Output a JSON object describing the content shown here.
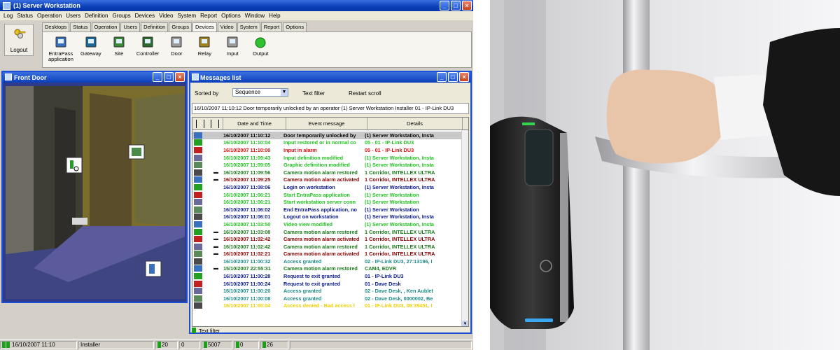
{
  "window": {
    "title": "(1)  Server Workstation"
  },
  "menu": [
    "Log",
    "Status",
    "Operation",
    "Users",
    "Definition",
    "Groups",
    "Devices",
    "Video",
    "System",
    "Report",
    "Options",
    "Window",
    "Help"
  ],
  "logout_label": "Logout",
  "tabs": [
    "Desktops",
    "Status",
    "Operation",
    "Users",
    "Definition",
    "Groups",
    "Devices",
    "Video",
    "System",
    "Report",
    "Options"
  ],
  "active_tab": "Devices",
  "toolbar": [
    {
      "label": "EntraPass\napplication",
      "icon": "computer-icon"
    },
    {
      "label": "Gateway",
      "icon": "gateway-icon"
    },
    {
      "label": "Site",
      "icon": "site-icon"
    },
    {
      "label": "Controller",
      "icon": "controller-icon"
    },
    {
      "label": "Door",
      "icon": "door-icon"
    },
    {
      "label": "Relay",
      "icon": "relay-icon"
    },
    {
      "label": "Input",
      "icon": "input-icon"
    },
    {
      "label": "Output",
      "icon": "output-icon"
    }
  ],
  "front_door": {
    "title": "Front Door"
  },
  "messages": {
    "title": "Messages list",
    "sorted_by_label": "Sorted by",
    "sorted_by_value": "Sequence",
    "text_filter_label": "Text filter",
    "restart_scroll_label": "Restart scroll",
    "last_message": "16/10/2007 11:10:12  Door temporarily unlocked by an operator  (1)  Server Workstation  Installer  01 - IP-Link DU3",
    "columns": [
      "Date and Time",
      "Event message",
      "Details"
    ],
    "rows": [
      {
        "dt": "16/10/2007 11:10:12",
        "ev": "Door temporarily unlocked by",
        "de": "(1)  Server Workstation, Insta",
        "color": "#000000",
        "cam": false,
        "selected": true
      },
      {
        "dt": "16/10/2007 11:10:04",
        "ev": "Input restored or in normal co",
        "de": "05 - 01 - IP-Link DU3",
        "color": "#22c322",
        "cam": false
      },
      {
        "dt": "16/10/2007 11:10:00",
        "ev": "Input in alarm",
        "de": "05 - 01 - IP-Link DU3",
        "color": "#e21010",
        "cam": false
      },
      {
        "dt": "16/10/2007 11:09:43",
        "ev": "Input definition modified",
        "de": "(1)  Server Workstation, Insta",
        "color": "#22c322",
        "cam": false
      },
      {
        "dt": "16/10/2007 11:09:05",
        "ev": "Graphic definition modified",
        "de": "(1)  Server Workstation, Insta",
        "color": "#22c322",
        "cam": false
      },
      {
        "dt": "16/10/2007 11:09:56",
        "ev": "Camera motion alarm restored",
        "de": "1 Corridor, INTELLEX ULTRA",
        "color": "#1a7a1a",
        "cam": true
      },
      {
        "dt": "16/10/2007 11:09:25",
        "ev": "Camera motion alarm activated",
        "de": "1 Corridor, INTELLEX ULTRA",
        "color": "#8b0000",
        "cam": true
      },
      {
        "dt": "16/10/2007 11:08:06",
        "ev": "Login on workstation",
        "de": "(1)  Server Workstation, Insta",
        "color": "#0a1a8c",
        "cam": false
      },
      {
        "dt": "16/10/2007 11:06:21",
        "ev": "Start EntraPass application",
        "de": "(1)  Server Workstation",
        "color": "#22c322",
        "cam": false
      },
      {
        "dt": "16/10/2007 11:06:21",
        "ev": "Start workstation server conn",
        "de": "(1)  Server Workstation",
        "color": "#22c322",
        "cam": false
      },
      {
        "dt": "16/10/2007 11:06:02",
        "ev": "End EntraPass application, no",
        "de": "(1)  Server Workstation",
        "color": "#0a1a8c",
        "cam": false
      },
      {
        "dt": "16/10/2007 11:06:01",
        "ev": "Logout on workstation",
        "de": "(1)  Server Workstation, Insta",
        "color": "#0a1a8c",
        "cam": false
      },
      {
        "dt": "16/10/2007 11:03:50",
        "ev": "Video view modified",
        "de": "(1)  Server Workstation, Insta",
        "color": "#22c322",
        "cam": false
      },
      {
        "dt": "16/10/2007 11:03:08",
        "ev": "Camera motion alarm restored",
        "de": "1 Corridor, INTELLEX ULTRA",
        "color": "#1a7a1a",
        "cam": true
      },
      {
        "dt": "16/10/2007 11:02:42",
        "ev": "Camera motion alarm activated",
        "de": "1 Corridor, INTELLEX ULTRA",
        "color": "#8b0000",
        "cam": true
      },
      {
        "dt": "16/10/2007 11:02:42",
        "ev": "Camera motion alarm restored",
        "de": "1 Corridor, INTELLEX ULTRA",
        "color": "#1a7a1a",
        "cam": true
      },
      {
        "dt": "16/10/2007 11:02:21",
        "ev": "Camera motion alarm activated",
        "de": "1 Corridor, INTELLEX ULTRA",
        "color": "#8b0000",
        "cam": true
      },
      {
        "dt": "16/10/2007 11:00:32",
        "ev": "Access granted",
        "de": "02 - IP-Link DU3, 27:13196, I",
        "color": "#1e8a8a",
        "cam": false
      },
      {
        "dt": "15/10/2007 22:55:31",
        "ev": "Camera motion alarm restored",
        "de": "CAM4, EDVR",
        "color": "#1a7a1a",
        "cam": true
      },
      {
        "dt": "16/10/2007 11:00:28",
        "ev": "Request to exit granted",
        "de": "01 - IP-Link DU3",
        "color": "#0a1a8c",
        "cam": false
      },
      {
        "dt": "16/10/2007 11:00:24",
        "ev": "Request to exit granted",
        "de": "01 - Dave Desk",
        "color": "#0a1a8c",
        "cam": false
      },
      {
        "dt": "16/10/2007 11:00:20",
        "ev": "Access granted",
        "de": "02 - Dave Desk, , Ken Aublet",
        "color": "#1e8a8a",
        "cam": false
      },
      {
        "dt": "16/10/2007 11:00:08",
        "ev": "Access granted",
        "de": "02 - Dave Desk, 0000002, Be",
        "color": "#1e8a8a",
        "cam": false
      },
      {
        "dt": "16/10/2007 11:00:04",
        "ev": "Access denied - Bad access l",
        "de": "01 - IP-Link DU3, 06:39451, I",
        "color": "#f0d000",
        "cam": false
      }
    ],
    "text_filter_footer": "Text filter"
  },
  "statusbar": {
    "datetime": "16/10/2007 11:10",
    "user": "Installer",
    "counts": [
      "20",
      "0",
      "5007",
      "0",
      "26"
    ]
  },
  "colors": {
    "titlebar": "#0a3fb8",
    "window_bg": "#d4d0c8",
    "status_green": "#1aa01a"
  }
}
